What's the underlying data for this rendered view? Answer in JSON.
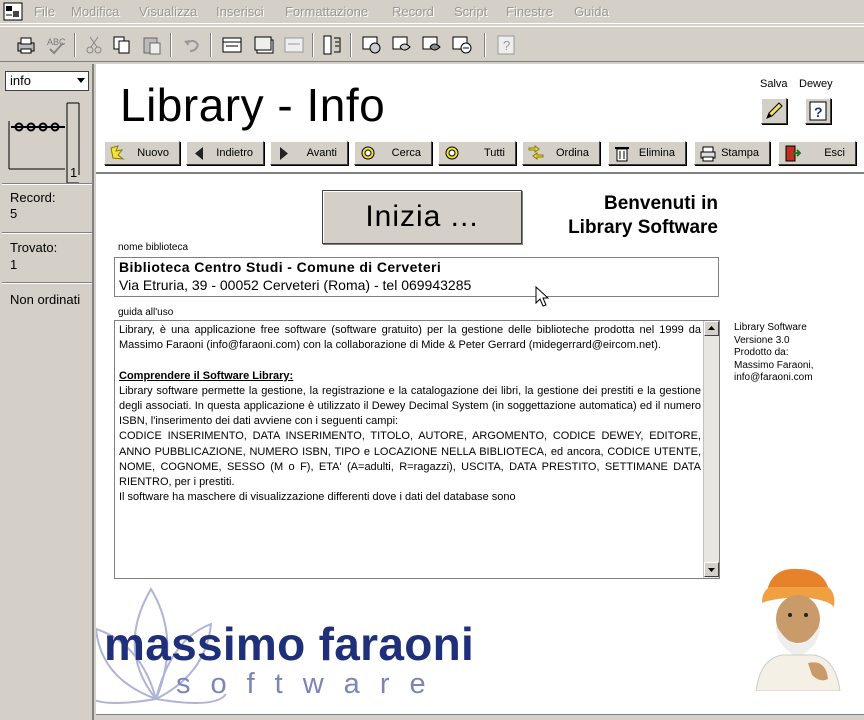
{
  "menubar": {
    "items": [
      "File",
      "Modifica",
      "Visualizza",
      "Inserisci",
      "Formattazione",
      "Record",
      "Script",
      "Finestre",
      "Guida"
    ]
  },
  "status": {
    "layout": "info",
    "page_number": "1",
    "record_label": "Record:",
    "record_value": "5",
    "found_label": "Trovato:",
    "found_value": "1",
    "sort_status": "Non ordinati"
  },
  "header": {
    "title": "Library - Info",
    "save_label": "Salva",
    "dewey_label": "Dewey",
    "buttons": [
      {
        "label": "Nuovo",
        "icon": "new-record-icon"
      },
      {
        "label": "Indietro",
        "icon": "back-arrow-icon"
      },
      {
        "label": "Avanti",
        "icon": "forward-arrow-icon"
      },
      {
        "label": "Cerca",
        "icon": "magnifier-icon"
      },
      {
        "label": "Tutti",
        "icon": "magnifier-icon"
      },
      {
        "label": "Ordina",
        "icon": "sort-icon"
      },
      {
        "label": "Elimina",
        "icon": "trash-icon"
      },
      {
        "label": "Stampa",
        "icon": "printer-icon"
      },
      {
        "label": "Esci",
        "icon": "exit-door-icon"
      }
    ]
  },
  "main": {
    "start_button": "Inizia ...",
    "welcome_line1": "Benvenuti in",
    "welcome_line2": "Library Software",
    "library_label": "nome biblioteca",
    "library_name": "Biblioteca Centro Studi - Comune di Cerveteri",
    "library_address": "Via Etruria, 39 - 00052 Cerveteri (Roma) - tel 069943285",
    "guide_label": "guida all'uso",
    "guide_intro": "Library, è una applicazione free software (software gratuito) per la gestione delle biblioteche prodotta nel 1999 da Massimo Faraoni (info@faraoni.com) con la collaborazione di Mide & Peter Gerrard (midegerrard@eircom.net).",
    "guide_heading": "Comprendere il Software Library:",
    "guide_body": "Library software permette la gestione, la registrazione e la catalogazione dei libri, la gestione dei prestiti e la gestione degli associati. In questa applicazione è utilizzato il Dewey Decimal System (in soggettazione automatica) ed il numero ISBN, l'inserimento dei dati avviene con i seguenti campi:\nCODICE INSERIMENTO, DATA INSERIMENTO, TITOLO, AUTORE, ARGOMENTO, CODICE DEWEY, EDITORE, ANNO PUBBLICAZIONE, NUMERO ISBN, TIPO e LOCAZIONE NELLA BIBLIOTECA, ed ancora, CODICE UTENTE, NOME, COGNOME, SESSO (M o F), ETA' (A=adulti, R=ragazzi), USCITA, DATA PRESTITO, SETTIMANE DATA RIENTRO, per i prestiti.\nIl software ha maschere di visualizzazione differenti dove i dati del database sono",
    "side_info": [
      "Library Software",
      "Versione 3.0",
      "Prodotto da:",
      "Massimo Faraoni,",
      "info@faraoni.com"
    ],
    "logo_main": "massimo faraoni",
    "logo_sub": "software"
  },
  "colors": {
    "chrome": "#d4d0c8",
    "logo_dark": "#1f2f7a",
    "logo_light": "#7d84b9"
  }
}
